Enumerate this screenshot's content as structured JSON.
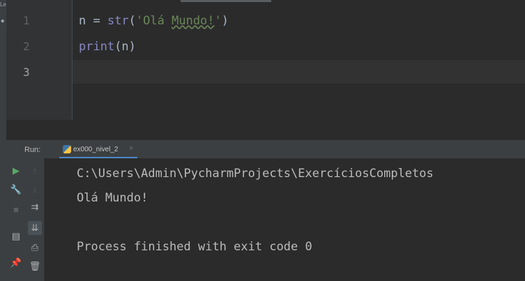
{
  "sidebar": {
    "label": "Le"
  },
  "editor": {
    "line_numbers": [
      "1",
      "2",
      "3"
    ],
    "lines": {
      "l1": {
        "var": "n = ",
        "func": "str",
        "open": "(",
        "quote_open": "'Olá ",
        "squiggle": "Mundo!",
        "quote_close": "'",
        "close": ")"
      },
      "l2": {
        "func": "print",
        "rest": "(n)"
      }
    }
  },
  "run_panel": {
    "label": "Run:",
    "tab_name": "ex000_nivel_2",
    "tab_close": "×",
    "console_lines": [
      "C:\\Users\\Admin\\PycharmProjects\\ExercíciosCompletos",
      "Olá Mundo!",
      "Process finished with exit code 0"
    ]
  },
  "icons": [
    "rerun-icon",
    "up-arrow-icon",
    "wrench-icon",
    "down-arrow-icon",
    "stop-icon",
    "soft-wrap-icon",
    "scroll-to-end-icon",
    "layout-icon",
    "print-icon",
    "pin-icon",
    "trash-icon"
  ],
  "colors": {
    "background": "#2b2b2b",
    "panel": "#3c3f41",
    "string": "#6a8759",
    "builtin": "#8888c6",
    "run_green": "#59a869",
    "tab_underline": "#4a88c7"
  }
}
